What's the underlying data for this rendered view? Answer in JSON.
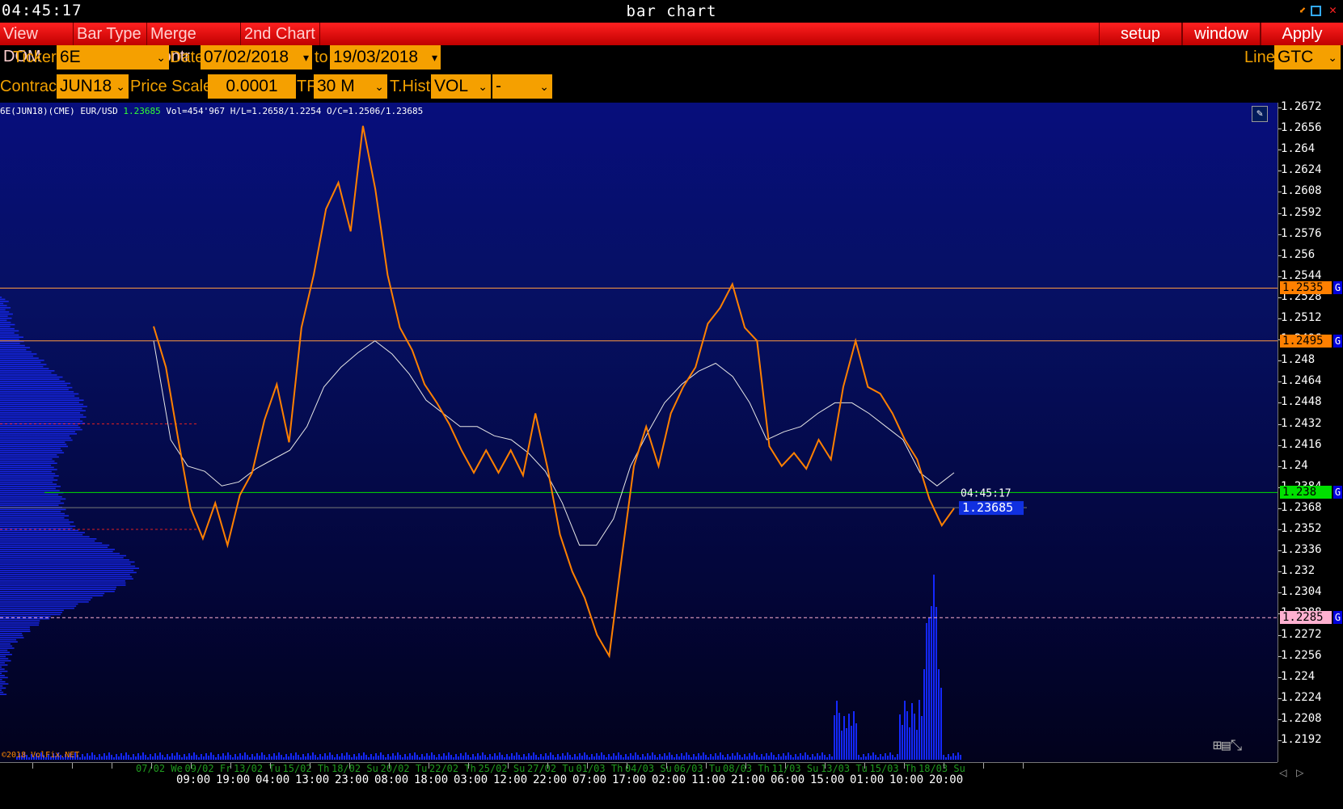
{
  "window": {
    "clock": "04:45:17",
    "title": "bar chart"
  },
  "menu": {
    "left": [
      "View DOM",
      "Bar Type",
      "Merge Contr",
      "2nd Chart"
    ],
    "right": [
      "setup",
      "window",
      "Apply"
    ]
  },
  "toolbar": {
    "ticker_label": "Ticker",
    "ticker_value": "6E",
    "date_label": "Date",
    "date_from": "07/02/2018",
    "to_label": "to",
    "date_to": "19/03/2018",
    "line_label": "Line",
    "line_value": "GTC",
    "contract_label": "Contract",
    "contract_value": "JUN18",
    "price_scale_label": "Price Scale",
    "price_scale_value": "0.0001",
    "tf_label": "TF",
    "tf_value": "30 M",
    "thist_label": "T.Hist",
    "thist_value": "VOL",
    "thist_extra": "-"
  },
  "info": {
    "symbol": "6E(JUN18)(CME) EUR/USD",
    "last": "1.23685",
    "stats": "Vol=454'967  H/L=1.2658/1.2254  O/C=1.2506/1.23685"
  },
  "copyright": "©2018 VolFix.NET",
  "colors": {
    "price_line": "#ff8000",
    "vwap_line": "#e6e6e6",
    "volume": "#1428ff",
    "level_line": "#ff9a40",
    "current_level": "#00e000",
    "low_level": "#ffb0d0"
  },
  "chart_data": {
    "type": "line",
    "title": "bar chart",
    "ylim": [
      1.218,
      1.2675
    ],
    "y_ticks": [
      "1.2672",
      "1.2656",
      "1.264",
      "1.2624",
      "1.2608",
      "1.2592",
      "1.2576",
      "1.256",
      "1.2544",
      "1.2528",
      "1.2512",
      "1.2496",
      "1.248",
      "1.2464",
      "1.2448",
      "1.2432",
      "1.2416",
      "1.24",
      "1.2384",
      "1.2368",
      "1.2352",
      "1.2336",
      "1.232",
      "1.2304",
      "1.2288",
      "1.2272",
      "1.2256",
      "1.224",
      "1.2224",
      "1.2208",
      "1.2192"
    ],
    "x_date_labels": [
      "07/02 We",
      "09/02 Fr",
      "13/02 Tu",
      "15/02 Th",
      "18/02 Su",
      "20/02 Tu",
      "22/02 Th",
      "25/02 Su",
      "27/02 Tu",
      "01/03 Th",
      "04/03 Su",
      "06/03 Tu",
      "08/03 Th",
      "11/03 Su",
      "13/03 Tu",
      "15/03 Th",
      "18/03 Su"
    ],
    "x_time_labels": [
      "09:00",
      "19:00",
      "04:00",
      "13:00",
      "23:00",
      "08:00",
      "18:00",
      "03:00",
      "12:00",
      "22:00",
      "07:00",
      "17:00",
      "02:00",
      "11:00",
      "21:00",
      "06:00",
      "15:00",
      "01:00",
      "10:00",
      "20:00"
    ],
    "series": [
      {
        "values": [
          1.2506,
          1.2475,
          1.242,
          1.2368,
          1.2345,
          1.2372,
          1.234,
          1.2378,
          1.2395,
          1.2435,
          1.2462,
          1.2418,
          1.2505,
          1.2545,
          1.2595,
          1.2615,
          1.2578,
          1.2658,
          1.261,
          1.2545,
          1.2505,
          1.2488,
          1.2462,
          1.2448,
          1.2432,
          1.2412,
          1.2395,
          1.2412,
          1.2395,
          1.2412,
          1.2393,
          1.244,
          1.2398,
          1.2348,
          1.232,
          1.23,
          1.2272,
          1.2256,
          1.233,
          1.24,
          1.243,
          1.24,
          1.244,
          1.246,
          1.2475,
          1.2508,
          1.252,
          1.2538,
          1.2505,
          1.2495,
          1.2415,
          1.24,
          1.241,
          1.2398,
          1.242,
          1.2405,
          1.246,
          1.2495,
          1.246,
          1.2455,
          1.244,
          1.242,
          1.2405,
          1.2375,
          1.2355,
          1.2368
        ]
      },
      {
        "values": [
          1.2495,
          1.242,
          1.24,
          1.2396,
          1.2385,
          1.2388,
          1.2398,
          1.2405,
          1.2412,
          1.243,
          1.246,
          1.2475,
          1.2486,
          1.2495,
          1.2485,
          1.247,
          1.245,
          1.244,
          1.243,
          1.243,
          1.2423,
          1.242,
          1.241,
          1.2396,
          1.2372,
          1.234,
          1.234,
          1.236,
          1.24,
          1.2425,
          1.2448,
          1.2462,
          1.2472,
          1.2478,
          1.2468,
          1.2448,
          1.242,
          1.2426,
          1.243,
          1.244,
          1.2448,
          1.2448,
          1.244,
          1.243,
          1.242,
          1.2395,
          1.2385,
          1.2395
        ]
      }
    ],
    "levels": [
      {
        "value": "1.2535",
        "tag": "G"
      },
      {
        "value": "1.2495",
        "tag": "G"
      },
      {
        "value": "1.238",
        "tag": "G"
      },
      {
        "value": "1.2285",
        "tag": "G"
      }
    ],
    "current_price": "1.23685",
    "current_time": "04:45:17"
  }
}
